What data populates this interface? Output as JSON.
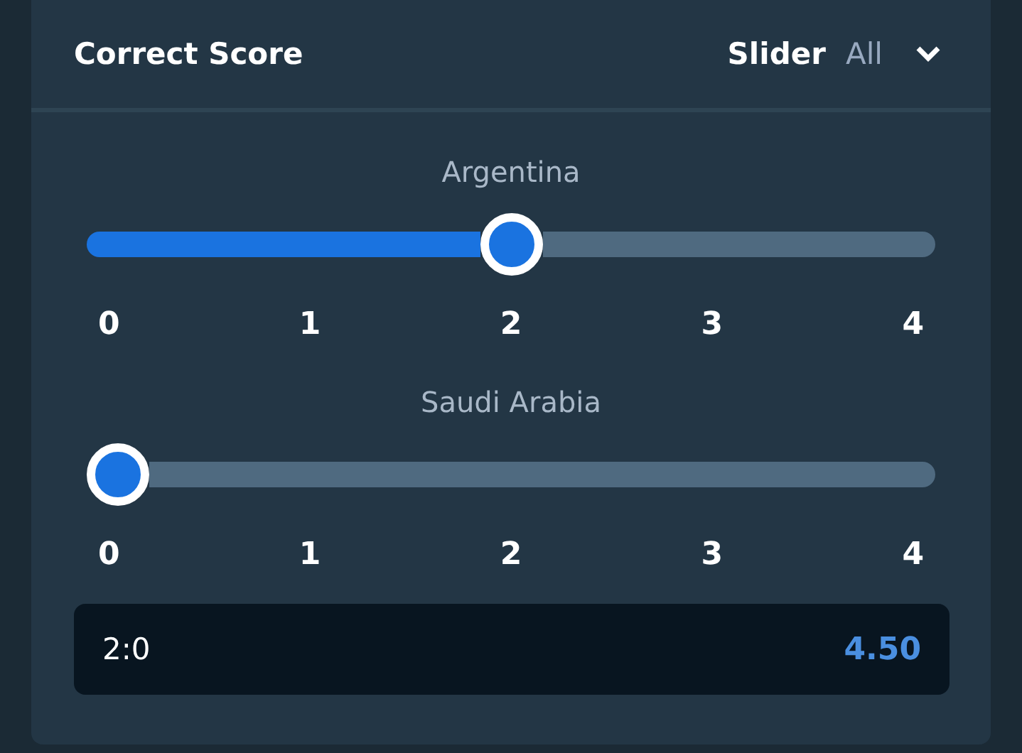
{
  "header": {
    "title": "Correct Score",
    "mode": "Slider",
    "filter": "All"
  },
  "sliders": [
    {
      "team": "Argentina",
      "level": 0.5,
      "ticks": [
        "0",
        "1",
        "2",
        "3",
        "4"
      ]
    },
    {
      "team": "Saudi Arabia",
      "level": 0,
      "ticks": [
        "0",
        "1",
        "2",
        "3",
        "4"
      ]
    }
  ],
  "result": {
    "score": "2:0",
    "odds": "4.50"
  }
}
